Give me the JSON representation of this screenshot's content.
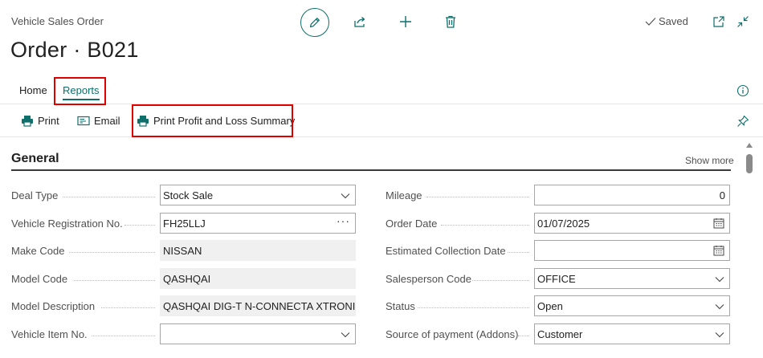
{
  "header": {
    "caption": "Vehicle Sales Order",
    "title": "Order · B021",
    "saved_label": "Saved"
  },
  "tabs": [
    {
      "label": "Home",
      "active": false
    },
    {
      "label": "Reports",
      "active": true,
      "highlighted": true
    }
  ],
  "actions": [
    {
      "label": "Print",
      "icon": "printer-icon"
    },
    {
      "label": "Email",
      "icon": "email-icon"
    },
    {
      "label": "Print Profit and Loss Summary",
      "icon": "printer-icon",
      "highlighted": true
    }
  ],
  "section": {
    "title": "General",
    "show_more": "Show more"
  },
  "left_fields": [
    {
      "label": "Deal Type",
      "value": "Stock Sale",
      "kind": "dropdown"
    },
    {
      "label": "Vehicle Registration No.",
      "value": "FH25LLJ",
      "kind": "lookup"
    },
    {
      "label": "Make Code",
      "value": "NISSAN",
      "kind": "readonly"
    },
    {
      "label": "Model Code",
      "value": "QASHQAI",
      "kind": "readonly"
    },
    {
      "label": "Model Description",
      "value": "QASHQAI DIG-T N-CONNECTA XTRONIC",
      "kind": "readonly"
    },
    {
      "label": "Vehicle Item No.",
      "value": "",
      "kind": "dropdown"
    }
  ],
  "right_fields": [
    {
      "label": "Mileage",
      "value": "0",
      "kind": "number"
    },
    {
      "label": "Order Date",
      "value": "01/07/2025",
      "kind": "date"
    },
    {
      "label": "Estimated Collection Date",
      "value": "",
      "kind": "date"
    },
    {
      "label": "Salesperson Code",
      "value": "OFFICE",
      "kind": "dropdown"
    },
    {
      "label": "Status",
      "value": "Open",
      "kind": "dropdown"
    },
    {
      "label": "Source of payment (Addons)",
      "value": "Customer",
      "kind": "dropdown"
    }
  ],
  "colors": {
    "accent": "#0f6f6b",
    "highlight_box": "#e00000",
    "readonly_bg": "#f0f0f0"
  }
}
